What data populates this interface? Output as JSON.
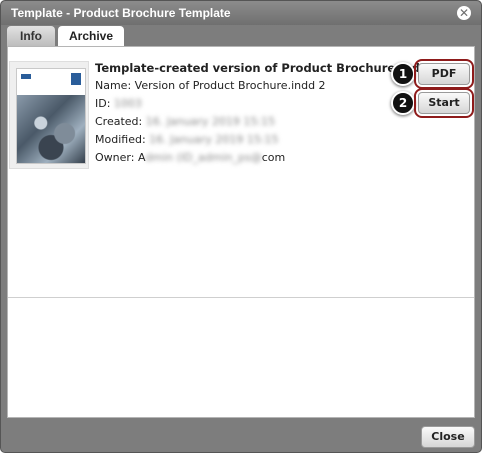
{
  "window": {
    "title": "Template - Product Brochure Template",
    "close_glyph": "✕"
  },
  "tabs": [
    {
      "label": "Info",
      "active": false
    },
    {
      "label": "Archive",
      "active": true
    }
  ],
  "item": {
    "title": "Template-created version of Product Brochure.indd",
    "name_label": "Name:",
    "name_value": "Version of Product Brochure.indd 2",
    "id_label": "ID:",
    "id_value": "1003",
    "created_label": "Created:",
    "created_value": "16. January 2019 15:15",
    "modified_label": "Modified:",
    "modified_value": "16. January 2019 15:15",
    "owner_label": "Owner:",
    "owner_value_hidden": "dmin (ID_admin_ps@",
    "owner_value_prefix": "A",
    "owner_value_suffix": "com"
  },
  "actions": {
    "pdf_label": "PDF",
    "start_label": "Start",
    "pdf_badge": "1",
    "start_badge": "2"
  },
  "footer": {
    "close_label": "Close"
  },
  "colors": {
    "dialog_bg": "#7d7d7d",
    "highlight": "#8e1b1b",
    "badge": "#111111",
    "brochure_accent": "#2a5d9a"
  },
  "icons": {
    "window_close": "close-icon",
    "thumbnail": "brochure-thumbnail"
  }
}
